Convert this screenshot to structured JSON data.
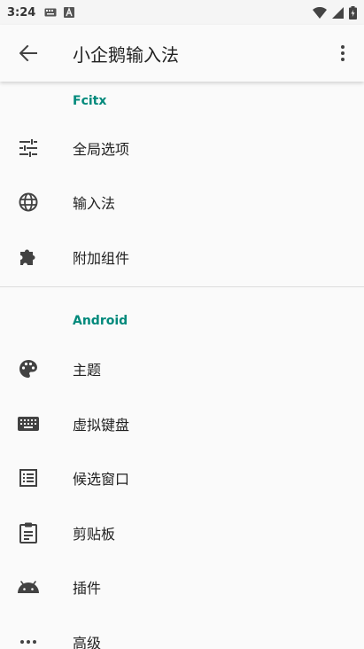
{
  "status_bar": {
    "time": "3:24"
  },
  "app_bar": {
    "title": "小企鹅输入法"
  },
  "sections": [
    {
      "header": "Fcitx",
      "items": [
        {
          "label": "全局选项",
          "icon": "tune-icon"
        },
        {
          "label": "输入法",
          "icon": "globe-icon"
        },
        {
          "label": "附加组件",
          "icon": "puzzle-icon"
        }
      ]
    },
    {
      "header": "Android",
      "items": [
        {
          "label": "主题",
          "icon": "palette-icon"
        },
        {
          "label": "虚拟键盘",
          "icon": "keyboard-icon"
        },
        {
          "label": "候选窗口",
          "icon": "list-icon"
        },
        {
          "label": "剪贴板",
          "icon": "clipboard-icon"
        },
        {
          "label": "插件",
          "icon": "android-icon"
        },
        {
          "label": "高级",
          "icon": "more-horiz-icon"
        }
      ]
    }
  ],
  "colors": {
    "accent": "#00897b",
    "icon": "#424242"
  }
}
